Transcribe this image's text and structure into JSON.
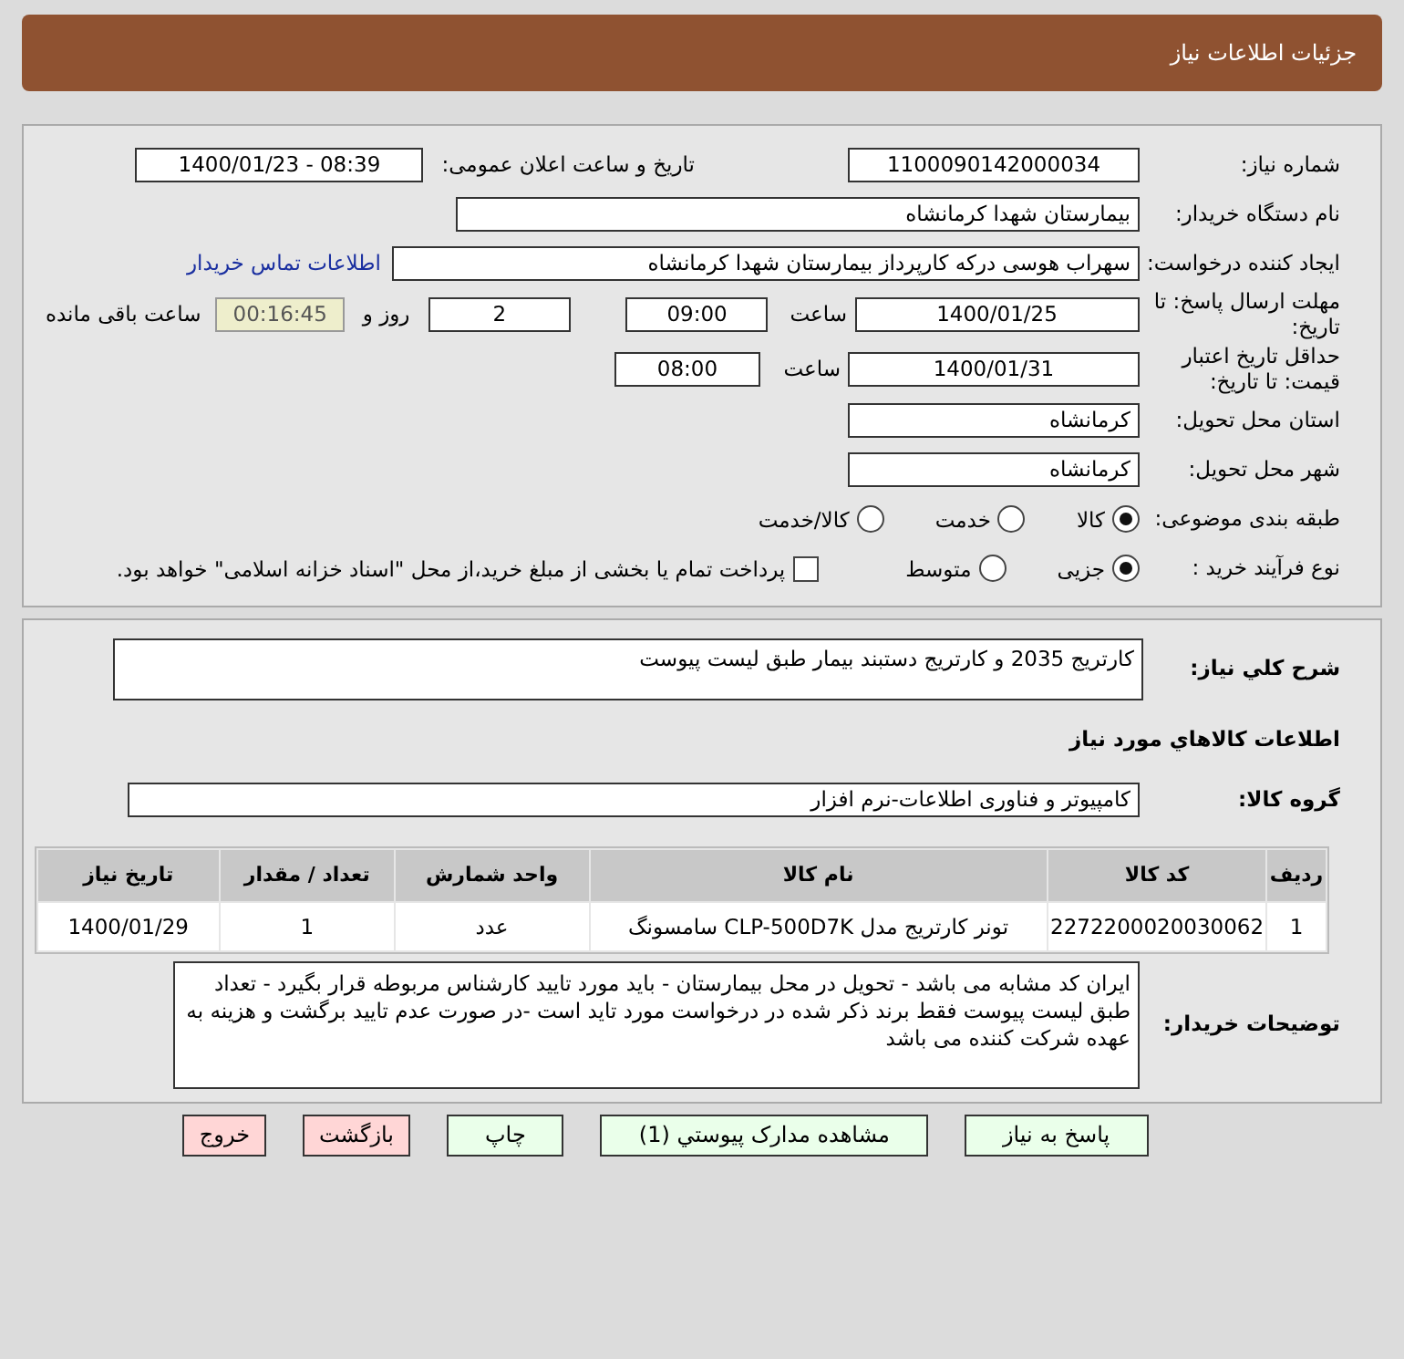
{
  "header": {
    "title": "جزئیات اطلاعات نیاز"
  },
  "need_number": {
    "label": "شماره نیاز:",
    "value": "1100090142000034"
  },
  "announce": {
    "label": "تاریخ و ساعت اعلان عمومی:",
    "value": "1400/01/23 - 08:39"
  },
  "buyer": {
    "label": "نام دستگاه خریدار:",
    "value": "بیمارستان شهدا کرمانشاه"
  },
  "creator": {
    "label": "ایجاد کننده درخواست:",
    "value": "سهراب هوسی درکه کارپرداز بیمارستان شهدا کرمانشاه",
    "link": "اطلاعات تماس خریدار"
  },
  "reply_deadline": {
    "label": "مهلت ارسال پاسخ: تا تاریخ:",
    "date": "1400/01/25",
    "time_label": "ساعت",
    "time": "09:00",
    "days": "2",
    "days_label": "روز و",
    "remaining": "00:16:45",
    "remaining_label": "ساعت باقی مانده"
  },
  "price_validity": {
    "label": "حداقل تاریخ اعتبار قیمت: تا تاریخ:",
    "date": "1400/01/31",
    "time_label": "ساعت",
    "time": "08:00"
  },
  "province": {
    "label": "استان محل تحویل:",
    "value": "کرمانشاه"
  },
  "city": {
    "label": "شهر محل تحویل:",
    "value": "کرمانشاه"
  },
  "category": {
    "label": "طبقه بندی موضوعی:",
    "options": [
      {
        "label": "کالا",
        "selected": true
      },
      {
        "label": "خدمت",
        "selected": false
      },
      {
        "label": "کالا/خدمت",
        "selected": false
      }
    ]
  },
  "process": {
    "label": "نوع فرآیند خرید :",
    "options": [
      {
        "label": "جزیی",
        "selected": true
      },
      {
        "label": "متوسط",
        "selected": false
      }
    ],
    "payment": {
      "checked": false,
      "text": "پرداخت تمام یا بخشی از مبلغ خرید،از محل \"اسناد خزانه اسلامی\" خواهد بود."
    }
  },
  "description": {
    "label": "شرح کلي نیاز:",
    "value": "کارتریج 2035 و کارتریج دستبند بیمار طبق لیست پیوست"
  },
  "goods_title": "اطلاعات کالاهاي مورد نیاز",
  "goods_group": {
    "label": "گروه کالا:",
    "value": "کامپیوتر و فناوری اطلاعات-نرم افزار"
  },
  "table": {
    "columns": [
      "ردیف",
      "کد کالا",
      "نام کالا",
      "واحد شمارش",
      "تعداد / مقدار",
      "تاریخ نیاز"
    ],
    "rows": [
      [
        "1",
        "2272200020030062",
        "تونر کارتریج مدل CLP-500D7K سامسونگ",
        "عدد",
        "1",
        "1400/01/29"
      ]
    ]
  },
  "buyer_notes": {
    "label": "توضیحات خریدار:",
    "value": "ایران کد مشابه می باشد - تحویل در محل بیمارستان - باید مورد تایید کارشناس مربوطه قرار بگیرد - تعداد طبق لیست پیوست  فقط برند ذکر شده در درخواست مورد تاید است -در صورت عدم تایید برگشت و هزینه به عهده شرکت کننده می باشد"
  },
  "buttons": [
    {
      "label": "پاسخ به نیاز",
      "kind": "normal"
    },
    {
      "label": "مشاهده مدارک پیوستي (1)",
      "kind": "normal"
    },
    {
      "label": "چاپ",
      "kind": "normal"
    },
    {
      "label": "بازگشت",
      "kind": "danger"
    },
    {
      "label": "خروج",
      "kind": "danger"
    }
  ]
}
